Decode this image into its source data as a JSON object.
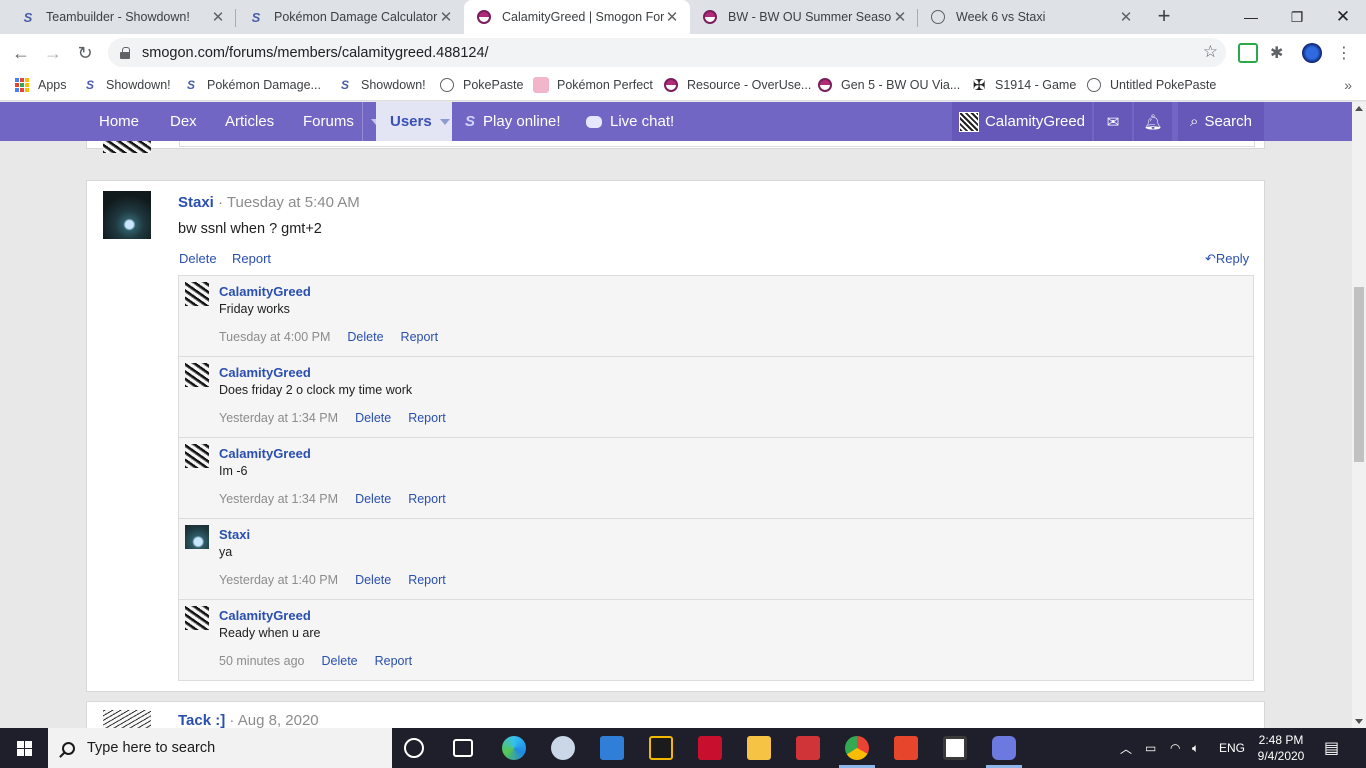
{
  "browser": {
    "tabs": [
      {
        "title": "Teambuilder - Showdown!",
        "icon": "showdown-icon"
      },
      {
        "title": "Pokémon Damage Calculator",
        "icon": "showdown-icon"
      },
      {
        "title": "CalamityGreed | Smogon Forums",
        "icon": "smogon-icon",
        "active": true
      },
      {
        "title": "BW - BW OU Summer Seasonal",
        "icon": "smogon-icon"
      },
      {
        "title": "Week 6 vs Staxi",
        "icon": "globe-icon"
      }
    ],
    "url": "smogon.com/forums/members/calamitygreed.488124/",
    "bookmarks": [
      {
        "label": "Apps",
        "icon": "apps-grid-icon"
      },
      {
        "label": "Showdown!",
        "icon": "showdown-icon"
      },
      {
        "label": "Pokémon Damage...",
        "icon": "showdown-icon"
      },
      {
        "label": "Showdown!",
        "icon": "showdown-icon"
      },
      {
        "label": "PokePaste",
        "icon": "globe-icon"
      },
      {
        "label": "Pokémon Perfect",
        "icon": "pokemon-perfect-icon"
      },
      {
        "label": "Resource - OverUse...",
        "icon": "smogon-icon"
      },
      {
        "label": "Gen 5 - BW OU Via...",
        "icon": "smogon-icon"
      },
      {
        "label": "S1914 - Game",
        "icon": "cross-icon"
      },
      {
        "label": "Untitled PokePaste",
        "icon": "globe-icon"
      }
    ]
  },
  "nav": {
    "home": "Home",
    "dex": "Dex",
    "articles": "Articles",
    "forums": "Forums",
    "users": "Users",
    "play": "Play online!",
    "chat": "Live chat!",
    "user": "CalamityGreed",
    "search": "Search"
  },
  "post": {
    "author": "Staxi",
    "time": "· Tuesday at 5:40 AM",
    "body": "bw ssnl when ? gmt+2",
    "delete": "Delete",
    "report": "Report",
    "reply": "Reply",
    "replies": [
      {
        "author": "CalamityGreed",
        "body": "Friday works",
        "time": "Tuesday at 4:00 PM",
        "avatar": "calamity"
      },
      {
        "author": "CalamityGreed",
        "body": "Does friday 2 o clock my time work",
        "time": "Yesterday at 1:34 PM",
        "avatar": "calamity"
      },
      {
        "author": "CalamityGreed",
        "body": "Im -6",
        "time": "Yesterday at 1:34 PM",
        "avatar": "calamity"
      },
      {
        "author": "Staxi",
        "body": "ya",
        "time": "Yesterday at 1:40 PM",
        "avatar": "staxi"
      },
      {
        "author": "CalamityGreed",
        "body": "Ready when u are",
        "time": "50 minutes ago",
        "avatar": "calamity"
      }
    ],
    "reply_delete": "Delete",
    "reply_report": "Report"
  },
  "next_post": {
    "author": "Tack :]",
    "time": "· Aug 8, 2020"
  },
  "taskbar": {
    "search_placeholder": "Type here to search",
    "language": "ENG",
    "time": "2:48 PM",
    "date": "9/4/2020"
  },
  "colors": {
    "nav_bg": "#7266c4",
    "link": "#2a4fb0",
    "taskbar": "#1f1f2b"
  }
}
